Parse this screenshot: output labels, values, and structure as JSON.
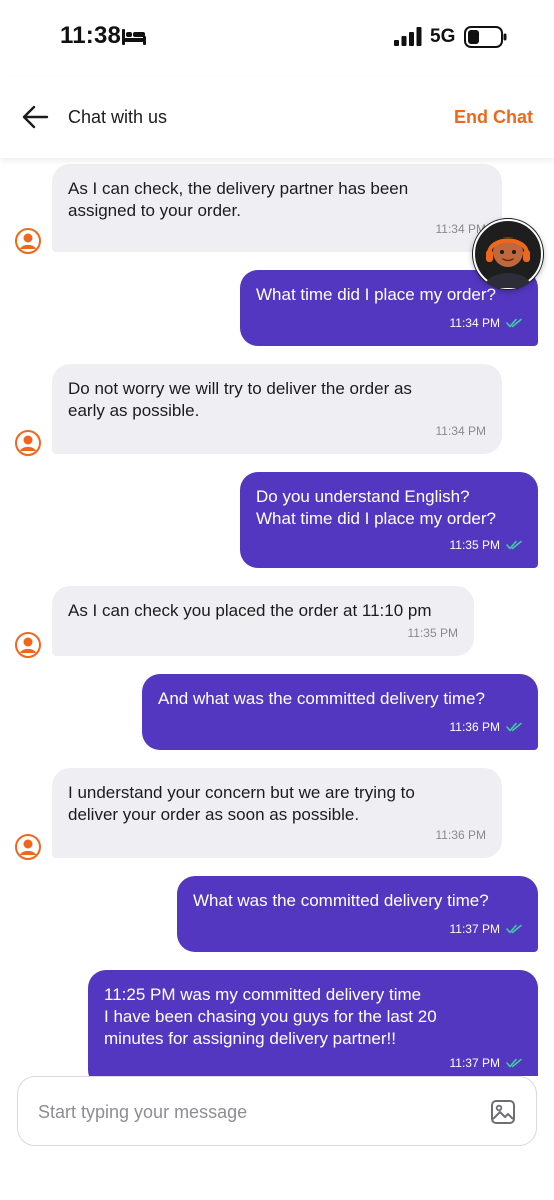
{
  "status_bar": {
    "time": "11:38",
    "network": "5G"
  },
  "header": {
    "title": "Chat with us",
    "end_chat_label": "End Chat"
  },
  "messages": [
    {
      "sender": "agent",
      "text": "As I can check, the delivery partner has been\nassigned to your order.",
      "time": "11:34 PM"
    },
    {
      "sender": "user",
      "text": "What time did I place my order?",
      "time": "11:34 PM"
    },
    {
      "sender": "agent",
      "text": "Do not worry we will try to deliver the order as\nearly as possible.",
      "time": "11:34 PM"
    },
    {
      "sender": "user",
      "text": "Do you understand English?\nWhat time did I place my order?",
      "time": "11:35 PM"
    },
    {
      "sender": "agent",
      "text": "As I can check you placed the order at 11:10 pm",
      "time": "11:35 PM"
    },
    {
      "sender": "user",
      "text": "And what was the committed delivery time?",
      "time": "11:36 PM"
    },
    {
      "sender": "agent",
      "text": "I understand your concern but we are trying to\ndeliver your order as soon as possible.",
      "time": "11:36 PM"
    },
    {
      "sender": "user",
      "text": "What was the committed delivery time?",
      "time": "11:37 PM"
    },
    {
      "sender": "user",
      "text": "11:25 PM was my committed delivery time\nI have been chasing you guys for the last 20\nminutes for assigning delivery partner!!",
      "time": "11:37 PM"
    }
  ],
  "composer": {
    "placeholder": "Start typing your message",
    "value": ""
  },
  "colors": {
    "accent": "#f0661b",
    "user_bubble": "#5437c1",
    "agent_bubble": "#efeff3",
    "read_tick": "#3fd0a0"
  },
  "icons": [
    "bed-icon",
    "signal-icon",
    "battery-icon",
    "back-arrow-icon",
    "double-check-icon",
    "agent-avatar-icon",
    "image-attach-icon"
  ]
}
